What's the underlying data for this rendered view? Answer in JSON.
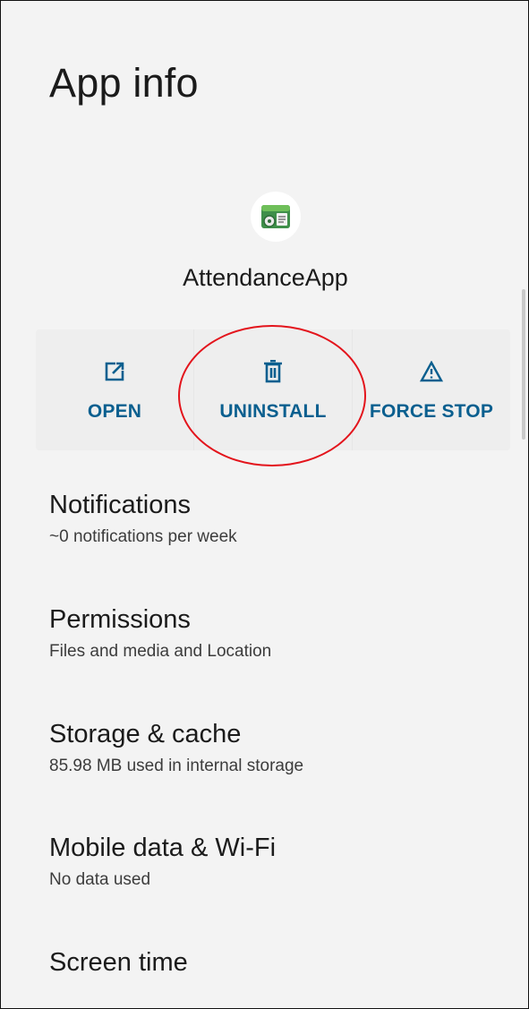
{
  "header": {
    "title": "App info"
  },
  "app": {
    "name": "AttendanceApp",
    "icon": "attendance-app-icon"
  },
  "actions": [
    {
      "label": "OPEN",
      "icon": "open-external-icon"
    },
    {
      "label": "UNINSTALL",
      "icon": "trash-icon"
    },
    {
      "label": "FORCE STOP",
      "icon": "warning-icon"
    }
  ],
  "settings": [
    {
      "title": "Notifications",
      "subtitle": "~0 notifications per week"
    },
    {
      "title": "Permissions",
      "subtitle": "Files and media and Location"
    },
    {
      "title": "Storage & cache",
      "subtitle": "85.98 MB used in internal storage"
    },
    {
      "title": "Mobile data & Wi-Fi",
      "subtitle": "No data used"
    },
    {
      "title": "Screen time",
      "subtitle": ""
    }
  ],
  "colors": {
    "accent": "#0a5f8f",
    "highlight": "#e3141c",
    "background": "#f3f3f3"
  }
}
